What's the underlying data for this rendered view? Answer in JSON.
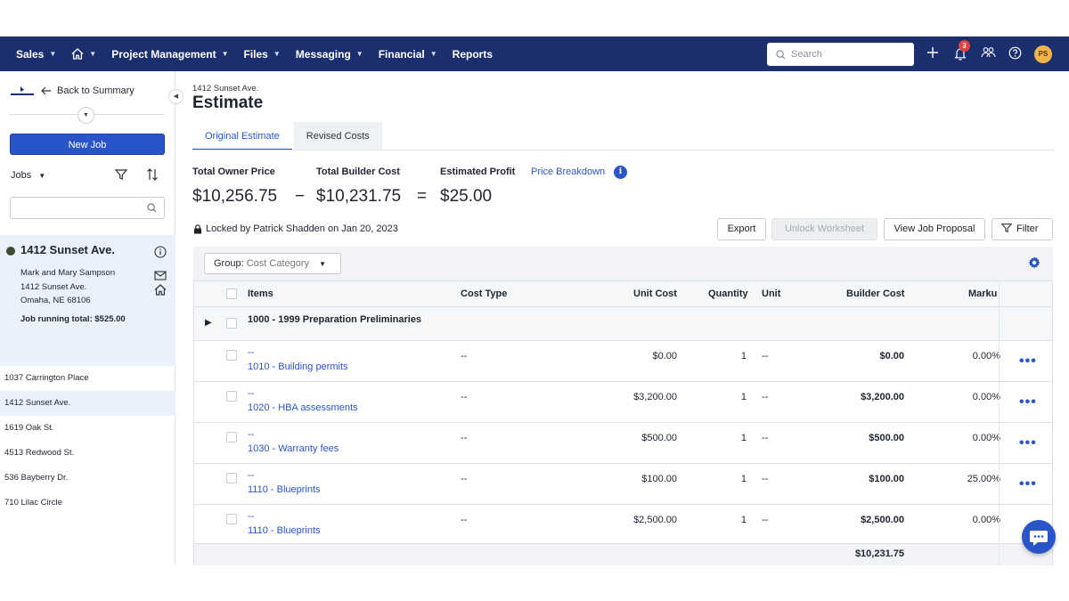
{
  "nav": {
    "items": [
      {
        "label": "Sales",
        "chevron": true
      },
      {
        "label": "",
        "icon": "home-icon",
        "chevron": true
      },
      {
        "label": "Project Management",
        "chevron": true
      },
      {
        "label": "Files",
        "chevron": true
      },
      {
        "label": "Messaging",
        "chevron": true
      },
      {
        "label": "Financial",
        "chevron": true
      },
      {
        "label": "Reports",
        "chevron": false
      }
    ],
    "search_placeholder": "Search",
    "notification_count": "3",
    "avatar_initials": "PS"
  },
  "sidebar": {
    "back_label": "Back to Summary",
    "new_job_label": "New Job",
    "jobs_label": "Jobs",
    "active_job": {
      "title": "1412 Sunset Ave.",
      "owner": "Mark and Mary Sampson",
      "street": "1412 Sunset Ave.",
      "city": "Omaha, NE 68106",
      "running_total": "Job running total: $525.00"
    },
    "job_list": [
      "1037 Carrington Place",
      "1412 Sunset Ave.",
      "1619 Oak St.",
      "4513 Redwood St.",
      "536 Bayberry Dr.",
      "710 Lilac Circle"
    ]
  },
  "main": {
    "breadcrumb": "1412 Sunset Ave.",
    "title": "Estimate",
    "tabs": [
      {
        "label": "Original Estimate"
      },
      {
        "label": "Revised Costs"
      }
    ],
    "summary": {
      "owner_label": "Total Owner Price",
      "builder_label": "Total Builder Cost",
      "profit_label": "Estimated Profit",
      "breakdown_label": "Price Breakdown",
      "owner_value": "$10,256.75",
      "minus": "−",
      "builder_value": "$10,231.75",
      "equals": "=",
      "profit_value": "$25.00"
    },
    "locked_text": "Locked by Patrick Shadden on Jan 20, 2023",
    "buttons": {
      "export": "Export",
      "unlock": "Unlock Worksheet",
      "proposal": "View Job Proposal",
      "filter": "Filter"
    },
    "group": {
      "label": "Group:",
      "value": "Cost Category"
    },
    "table": {
      "headers": {
        "items": "Items",
        "cost_type": "Cost Type",
        "unit_cost": "Unit Cost",
        "quantity": "Quantity",
        "unit": "Unit",
        "builder_cost": "Builder Cost",
        "markup": "Marku"
      },
      "group_title": "1000 - 1999 Preparation Preliminaries",
      "rows": [
        {
          "title": "--",
          "code": "1010 - Building permits",
          "cost_type": "--",
          "unit_cost": "$0.00",
          "qty": "1",
          "unit": "--",
          "builder_cost": "$0.00",
          "markup": "0.00%"
        },
        {
          "title": "--",
          "code": "1020 - HBA assessments",
          "cost_type": "--",
          "unit_cost": "$3,200.00",
          "qty": "1",
          "unit": "--",
          "builder_cost": "$3,200.00",
          "markup": "0.00%"
        },
        {
          "title": "--",
          "code": "1030 - Warranty fees",
          "cost_type": "--",
          "unit_cost": "$500.00",
          "qty": "1",
          "unit": "--",
          "builder_cost": "$500.00",
          "markup": "0.00%"
        },
        {
          "title": "--",
          "code": "1110 - Blueprints",
          "cost_type": "--",
          "unit_cost": "$100.00",
          "qty": "1",
          "unit": "--",
          "builder_cost": "$100.00",
          "markup": "25.00%"
        },
        {
          "title": "--",
          "code": "1110 - Blueprints",
          "cost_type": "--",
          "unit_cost": "$2,500.00",
          "qty": "1",
          "unit": "--",
          "builder_cost": "$2,500.00",
          "markup": "0.00%"
        }
      ],
      "total": "$10,231.75"
    }
  },
  "colors": {
    "nav_bg": "#1b2f6e",
    "accent": "#2a55c8",
    "active_job_bg": "#e9f1fb"
  }
}
